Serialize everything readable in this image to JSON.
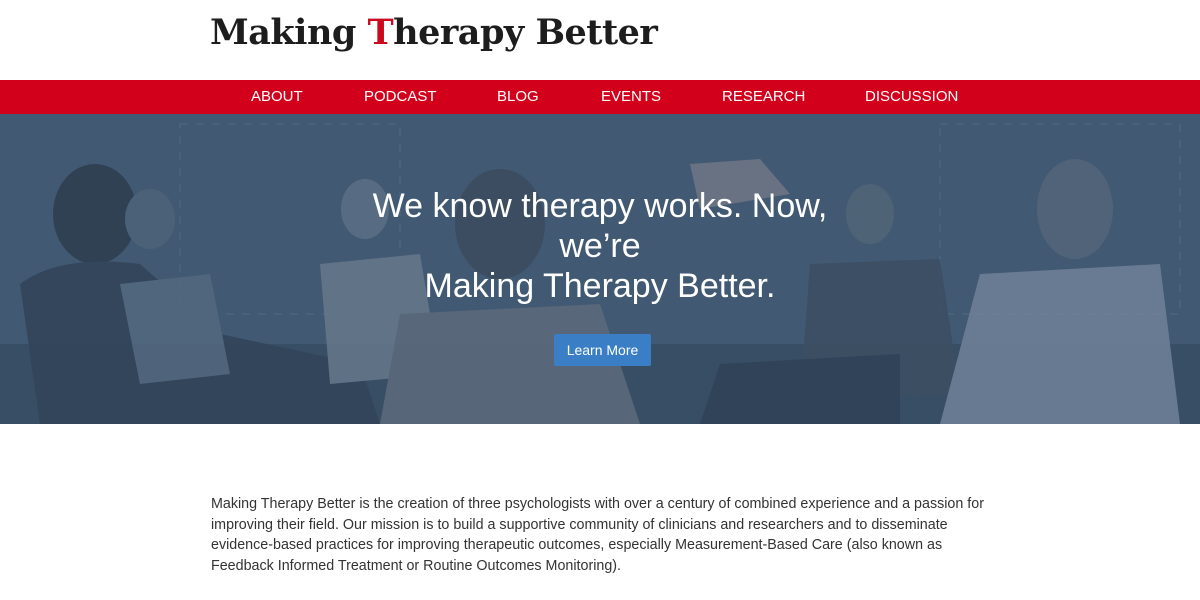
{
  "site": {
    "logo_part1": "Making ",
    "logo_accent": "T",
    "logo_part2": "herapy Better"
  },
  "nav": {
    "items": [
      {
        "label": "ABOUT"
      },
      {
        "label": "PODCAST"
      },
      {
        "label": "BLOG"
      },
      {
        "label": "EVENTS"
      },
      {
        "label": "RESEARCH"
      },
      {
        "label": "DISCUSSION"
      }
    ]
  },
  "hero": {
    "line1": "We know therapy works. Now,",
    "line2": "we’re",
    "line3": "Making Therapy Better.",
    "cta_label": "Learn More"
  },
  "intro": {
    "text": "Making Therapy Better is the creation of three psychologists with over a century of combined experience and a passion for improving their field. Our mission is to build a supportive community of clinicians and researchers and to disseminate evidence-based practices for improving therapeutic outcomes, especially Measurement-Based Care (also known as Feedback Informed Treatment or Routine Outcomes Monitoring)."
  },
  "colors": {
    "brand_red": "#d3001b",
    "logo_accent": "#cc0a1e",
    "cta_blue": "#3a7fc6",
    "hero_overlay": "#3e5570"
  }
}
